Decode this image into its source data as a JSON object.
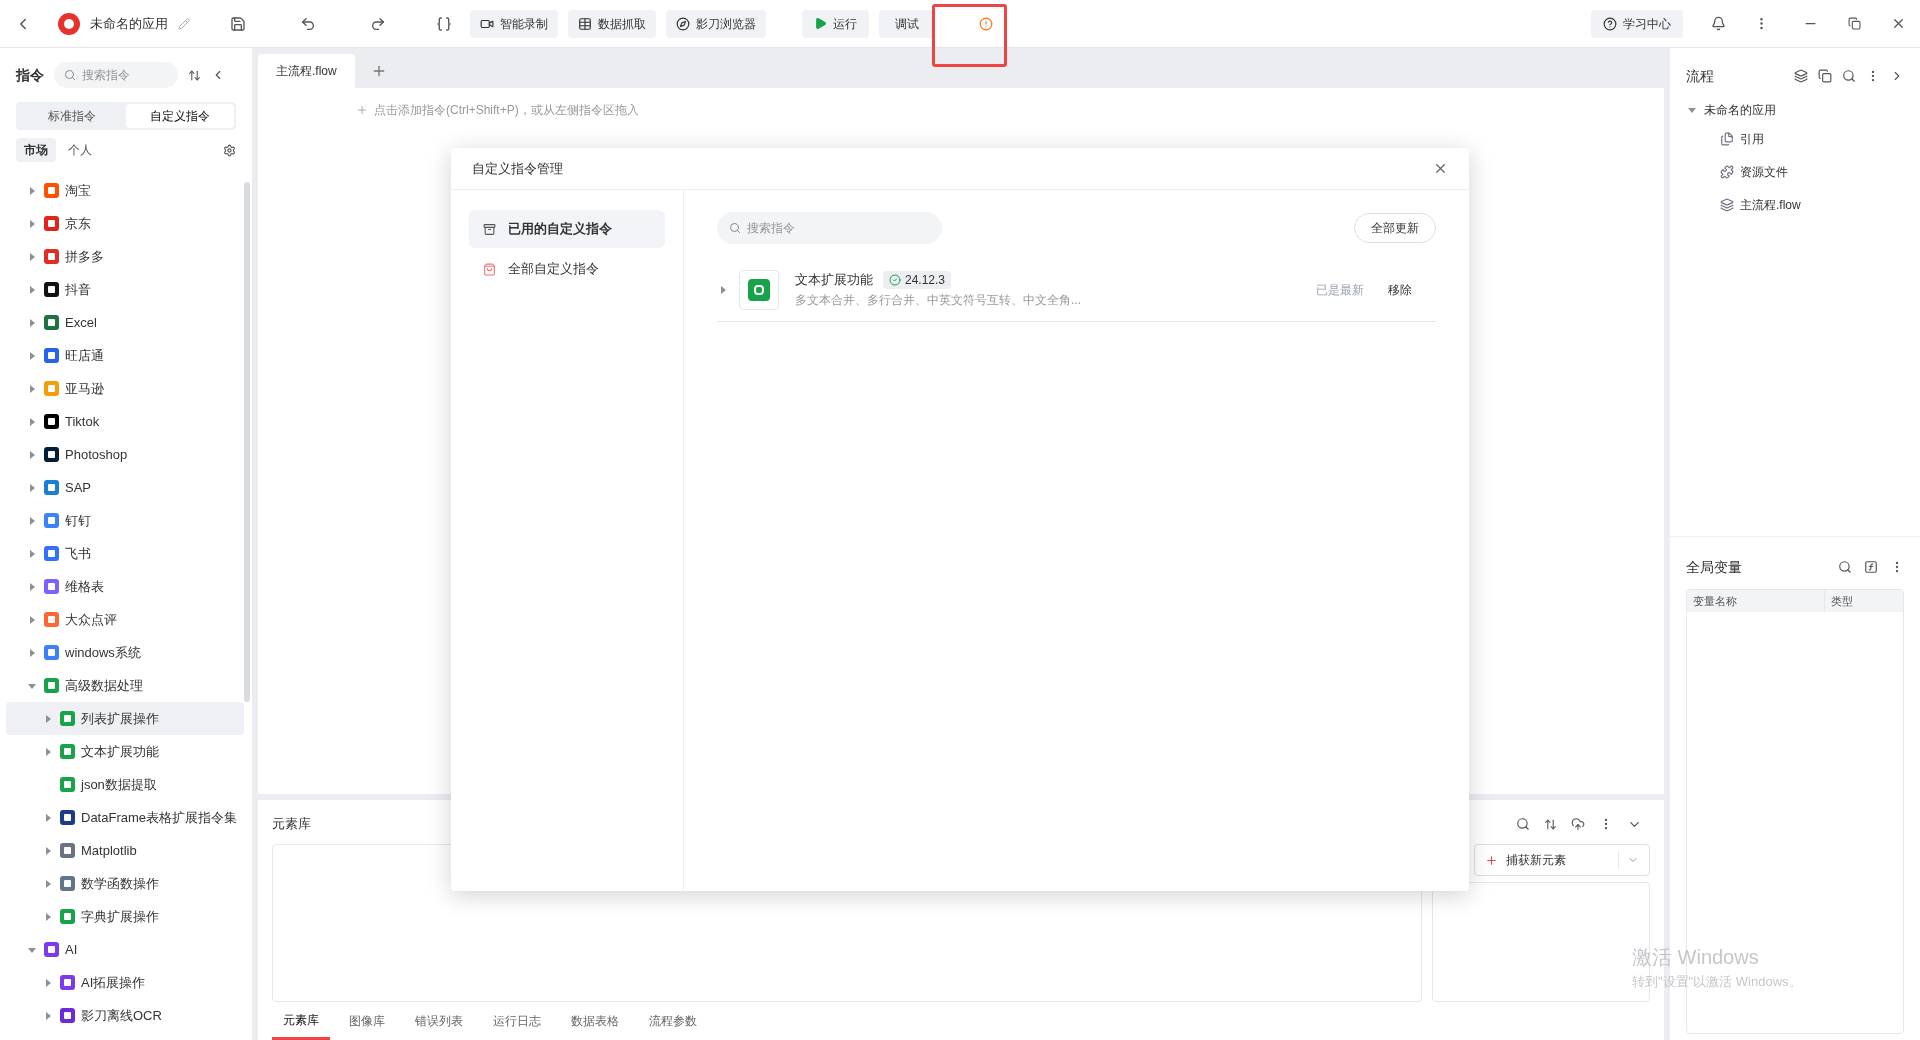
{
  "topbar": {
    "app_name": "未命名的应用",
    "buttons": [
      "智能录制",
      "数据抓取",
      "影刀浏览器"
    ],
    "run": "运行",
    "debug": "调试",
    "help": "学习中心",
    "highlight": true
  },
  "sidebar": {
    "title": "指令",
    "search": {
      "placeholder": "搜索指令"
    },
    "segments": [
      {
        "label": "标准指令",
        "selected": false
      },
      {
        "label": "自定义指令",
        "selected": true
      }
    ],
    "subtabs": [
      {
        "label": "市场",
        "selected": true
      },
      {
        "label": "个人",
        "selected": false
      }
    ],
    "items": [
      {
        "label": "淘宝",
        "color": "#ff5000",
        "kind": "folder",
        "expanded": false,
        "selected": false
      },
      {
        "label": "京东",
        "color": "#e1251b",
        "kind": "folder",
        "expanded": false,
        "selected": false
      },
      {
        "label": "拼多多",
        "color": "#e02e24",
        "kind": "folder",
        "expanded": false,
        "selected": false
      },
      {
        "label": "抖音",
        "color": "#111111",
        "kind": "folder",
        "expanded": false,
        "selected": false
      },
      {
        "label": "Excel",
        "color": "#1f7244",
        "kind": "folder",
        "expanded": false,
        "selected": false
      },
      {
        "label": "旺店通",
        "color": "#2563eb",
        "kind": "folder",
        "expanded": false,
        "selected": false
      },
      {
        "label": "亚马逊",
        "color": "#f59e0b",
        "kind": "folder",
        "expanded": false,
        "selected": false
      },
      {
        "label": "Tiktok",
        "color": "#000000",
        "kind": "folder",
        "expanded": false,
        "selected": false
      },
      {
        "label": "Photoshop",
        "color": "#001e36",
        "kind": "folder",
        "expanded": false,
        "selected": false
      },
      {
        "label": "SAP",
        "color": "#1a7fd4",
        "kind": "folder",
        "expanded": false,
        "selected": false
      },
      {
        "label": "钉钉",
        "color": "#3b82f6",
        "kind": "folder",
        "expanded": false,
        "selected": false
      },
      {
        "label": "飞书",
        "color": "#3370ff",
        "kind": "folder",
        "expanded": false,
        "selected": false
      },
      {
        "label": "维格表",
        "color": "#7b61ff",
        "kind": "folder",
        "expanded": false,
        "selected": false
      },
      {
        "label": "大众点评",
        "color": "#ff6633",
        "kind": "folder",
        "expanded": false,
        "selected": false
      },
      {
        "label": "windows系统",
        "color": "#3b82f6",
        "kind": "folder",
        "expanded": false,
        "selected": false
      },
      {
        "label": "高级数据处理",
        "color": "#16a34a",
        "kind": "folder",
        "expanded": true,
        "selected": false,
        "children": [
          {
            "label": "列表扩展操作",
            "color": "#16a34a",
            "kind": "folder",
            "expanded": false,
            "selected": true
          },
          {
            "label": "文本扩展功能",
            "color": "#16a34a",
            "kind": "folder",
            "expanded": false,
            "selected": false
          },
          {
            "label": "json数据提取",
            "color": "#16a34a",
            "kind": "leaf",
            "selected": false
          },
          {
            "label": "DataFrame表格扩展指令集",
            "color": "#1e3a8a",
            "kind": "folder",
            "expanded": false,
            "selected": false
          },
          {
            "label": "Matplotlib",
            "color": "#6b7280",
            "kind": "folder",
            "expanded": false,
            "selected": false
          },
          {
            "label": "数学函数操作",
            "color": "#64748b",
            "kind": "folder",
            "expanded": false,
            "selected": false
          },
          {
            "label": "字典扩展操作",
            "color": "#16a34a",
            "kind": "folder",
            "expanded": false,
            "selected": false
          }
        ]
      },
      {
        "label": "AI",
        "color": "#7c3aed",
        "kind": "folder",
        "expanded": true,
        "selected": false,
        "children": [
          {
            "label": "AI拓展操作",
            "color": "#7c3aed",
            "kind": "folder",
            "expanded": false,
            "selected": false
          },
          {
            "label": "影刀离线OCR",
            "color": "#6d28d9",
            "kind": "folder",
            "expanded": false,
            "selected": false
          }
        ]
      }
    ]
  },
  "editor": {
    "tabs": [
      {
        "label": "主流程.flow",
        "selected": true
      }
    ],
    "hint": "点击添加指令(Ctrl+Shift+P)，或从左侧指令区拖入"
  },
  "element_panel": {
    "title": "元素库",
    "capture": "捕获新元素",
    "tabs": [
      {
        "label": "元素库",
        "selected": true
      },
      {
        "label": "图像库",
        "selected": false
      },
      {
        "label": "错误列表",
        "selected": false
      },
      {
        "label": "运行日志",
        "selected": false
      },
      {
        "label": "数据表格",
        "selected": false
      },
      {
        "label": "流程参数",
        "selected": false
      }
    ]
  },
  "flow_panel": {
    "title": "流程",
    "root": {
      "label": "未命名的应用",
      "expanded": true,
      "children": [
        {
          "label": "引用",
          "kind": "reference"
        },
        {
          "label": "资源文件",
          "kind": "resource"
        },
        {
          "label": "主流程.flow",
          "kind": "flow"
        }
      ]
    }
  },
  "variables": {
    "title": "全局变量",
    "columns": [
      "变量名称",
      "类型"
    ]
  },
  "dialog": {
    "title": "自定义指令管理",
    "nav": [
      {
        "label": "已用的自定义指令",
        "selected": true,
        "kind": "used"
      },
      {
        "label": "全部自定义指令",
        "selected": false,
        "kind": "all"
      }
    ],
    "search": {
      "placeholder": "搜索指令"
    },
    "update_all": "全部更新",
    "rows": [
      {
        "name": "文本扩展功能",
        "version": "24.12.3",
        "description": "多文本合并、多行合并、中英文符号互转、中文全角...",
        "status": "已是最新",
        "action": "移除"
      }
    ]
  },
  "watermark": {
    "title": "激活 Windows",
    "subtitle": "转到\"设置\"以激活 Windows。"
  }
}
